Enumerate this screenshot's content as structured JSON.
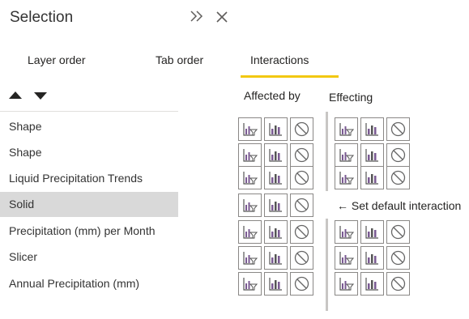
{
  "header": {
    "title": "Selection",
    "collapse_icon": "double-chevron-right-icon",
    "close_icon": "close-icon"
  },
  "tabs": [
    {
      "label": "Layer order"
    },
    {
      "label": "Tab order"
    },
    {
      "label": "Interactions",
      "active": true
    }
  ],
  "columns": {
    "affected_by": "Affected by",
    "effecting": "Effecting"
  },
  "rows": [
    {
      "label": "Shape"
    },
    {
      "label": "Shape"
    },
    {
      "label": "Liquid Precipitation Trends"
    },
    {
      "label": "Solid",
      "selected": true,
      "note": "← Set default interaction"
    },
    {
      "label": "Precipitation (mm) per Month"
    },
    {
      "label": "Slicer"
    },
    {
      "label": "Annual Precipitation (mm)"
    }
  ],
  "interaction_buttons": [
    "filter-icon",
    "highlight-icon",
    "none-icon"
  ],
  "colors": {
    "accent": "#f2c811",
    "icon_purple": "#7a5a92",
    "selected_row": "#d9d9d9"
  }
}
